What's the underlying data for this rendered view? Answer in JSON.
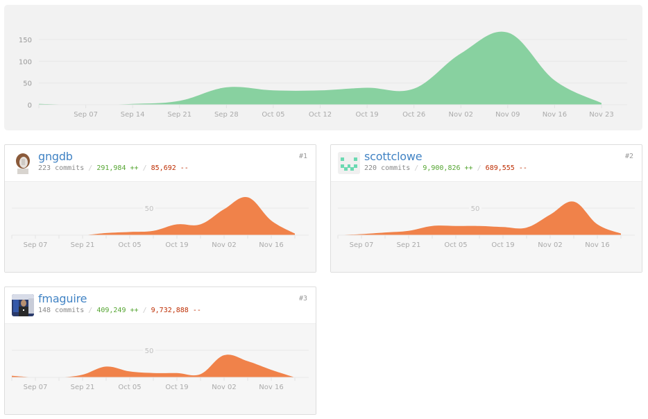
{
  "colors": {
    "main_area": "#88d1a0",
    "contributor_area": "#f0824a",
    "link": "#4183c4",
    "additions": "#55a532",
    "deletions": "#bd2c00"
  },
  "chart_data": [
    {
      "type": "area",
      "title": "",
      "xlabel": "",
      "ylabel": "",
      "x": [
        "Aug 31",
        "Sep 07",
        "Sep 14",
        "Sep 21",
        "Sep 28",
        "Oct 05",
        "Oct 12",
        "Oct 19",
        "Oct 26",
        "Nov 02",
        "Nov 09",
        "Nov 16",
        "Nov 23"
      ],
      "values": [
        2,
        0,
        2,
        9,
        40,
        33,
        33,
        39,
        37,
        118,
        166,
        56,
        4
      ],
      "xtick_labels": [
        "Sep 07",
        "Sep 14",
        "Sep 21",
        "Sep 28",
        "Oct 05",
        "Oct 12",
        "Oct 19",
        "Oct 26",
        "Nov 02",
        "Nov 09",
        "Nov 16",
        "Nov 23"
      ],
      "yticks": [
        0,
        50,
        100,
        150
      ],
      "ylim": [
        0,
        180
      ],
      "grid": true,
      "legend": "none"
    },
    {
      "type": "area",
      "title": "gngdb",
      "x": [
        "Aug 31",
        "Sep 07",
        "Sep 14",
        "Sep 21",
        "Sep 28",
        "Oct 05",
        "Oct 12",
        "Oct 19",
        "Oct 26",
        "Nov 02",
        "Nov 09",
        "Nov 16",
        "Nov 23"
      ],
      "values": [
        0,
        0,
        0,
        0,
        4,
        6,
        8,
        20,
        20,
        48,
        70,
        27,
        3
      ],
      "xtick_labels": [
        "Sep 07",
        "Sep 21",
        "Oct 05",
        "Oct 19",
        "Nov 02",
        "Nov 16"
      ],
      "yticks": [
        50
      ],
      "ylim": [
        0,
        80
      ],
      "grid": true
    },
    {
      "type": "area",
      "title": "scottclowe",
      "x": [
        "Aug 31",
        "Sep 07",
        "Sep 14",
        "Sep 21",
        "Sep 28",
        "Oct 05",
        "Oct 12",
        "Oct 19",
        "Oct 26",
        "Nov 02",
        "Nov 09",
        "Nov 16",
        "Nov 23"
      ],
      "values": [
        0,
        2,
        5,
        8,
        17,
        17,
        17,
        15,
        14,
        38,
        62,
        20,
        3
      ],
      "xtick_labels": [
        "Sep 07",
        "Sep 21",
        "Oct 05",
        "Oct 19",
        "Nov 02",
        "Nov 16"
      ],
      "yticks": [
        50
      ],
      "ylim": [
        0,
        80
      ],
      "grid": true
    },
    {
      "type": "area",
      "title": "fmaguire",
      "x": [
        "Aug 31",
        "Sep 07",
        "Sep 14",
        "Sep 21",
        "Sep 28",
        "Oct 05",
        "Oct 12",
        "Oct 19",
        "Oct 26",
        "Nov 02",
        "Nov 09",
        "Nov 16",
        "Nov 23"
      ],
      "values": [
        3,
        0,
        0,
        5,
        20,
        11,
        8,
        8,
        6,
        41,
        30,
        14,
        0
      ],
      "xtick_labels": [
        "Sep 07",
        "Sep 21",
        "Oct 05",
        "Oct 19",
        "Nov 02",
        "Nov 16"
      ],
      "yticks": [
        50
      ],
      "ylim": [
        0,
        80
      ],
      "grid": true
    }
  ],
  "contributors": [
    {
      "username": "gngdb",
      "rank": "#1",
      "commits": "223 commits",
      "additions": "291,984 ++",
      "deletions": "85,692 --",
      "avatar": "photo-avatar"
    },
    {
      "username": "scottclowe",
      "rank": "#2",
      "commits": "220 commits",
      "additions": "9,900,826 ++",
      "deletions": "689,555 --",
      "avatar": "identicon-avatar"
    },
    {
      "username": "fmaguire",
      "rank": "#3",
      "commits": "148 commits",
      "additions": "409,249 ++",
      "deletions": "9,732,888 --",
      "avatar": "photo-avatar"
    }
  ],
  "separator": "/"
}
